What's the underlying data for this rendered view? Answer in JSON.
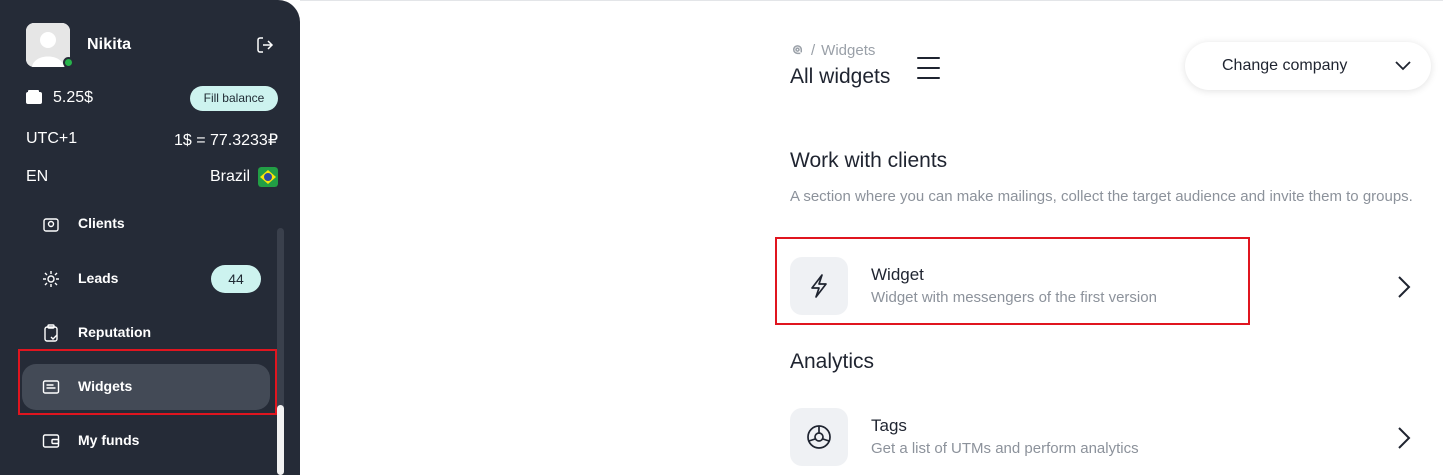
{
  "user": {
    "name": "Nikita",
    "balance": "5.25$",
    "fill_balance_label": "Fill balance",
    "timezone": "UTC+1",
    "exchange_rate": "1$ = 77.3233₽",
    "language": "EN",
    "country": "Brazil"
  },
  "sidebar": {
    "items": [
      {
        "label": "Clients",
        "icon": "clients-icon"
      },
      {
        "label": "Leads",
        "icon": "leads-icon",
        "badge": "44"
      },
      {
        "label": "Reputation",
        "icon": "clipboard-check-icon"
      },
      {
        "label": "Widgets",
        "icon": "widgets-icon",
        "active": true
      },
      {
        "label": "My funds",
        "icon": "wallet-icon"
      }
    ]
  },
  "breadcrumb": {
    "home_icon": "logo-icon",
    "separator": "/",
    "current": "Widgets"
  },
  "header": {
    "title": "All widgets",
    "change_company_label": "Change company"
  },
  "sections": [
    {
      "title": "Work with clients",
      "description": "A section where you can make mailings, collect the target audience and invite them to groups.",
      "widgets": [
        {
          "title": "Widget",
          "subtitle": "Widget with messengers of the first version",
          "icon": "lightning-icon"
        }
      ]
    },
    {
      "title": "Analytics",
      "widgets": [
        {
          "title": "Tags",
          "subtitle": "Get a list of UTMs and perform analytics",
          "icon": "chart-circle-icon"
        }
      ]
    }
  ],
  "colors": {
    "sidebar_bg": "#252b37",
    "accent_badge": "#cdf3ef",
    "highlight_red": "#e0151f",
    "online": "#27b34b"
  }
}
